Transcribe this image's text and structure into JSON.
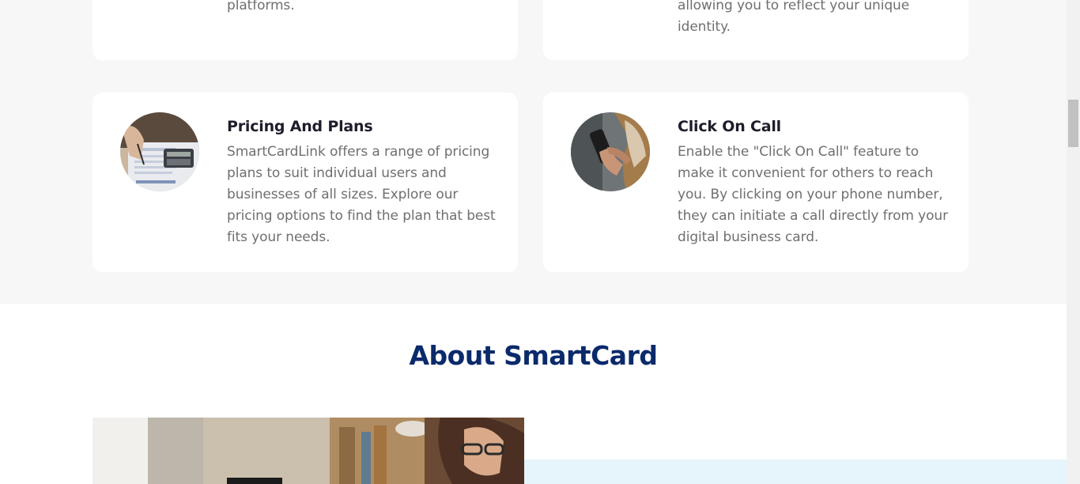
{
  "top_cards": {
    "left_tail": "platforms.",
    "right_tail_line1": "allowing you to reflect your unique",
    "right_tail_line2": "identity."
  },
  "cards": [
    {
      "title": "Pricing And Plans",
      "lines": [
        "SmartCardLink offers a range of pricing",
        "plans to suit individual users and",
        "businesses of all sizes. Explore our",
        "pricing options to find the plan that best",
        "fits your needs."
      ],
      "image_icon": "pricing-photo"
    },
    {
      "title": "Click On Call",
      "lines": [
        "Enable the \"Click On Call\" feature to",
        "make it convenient for others to reach",
        "you. By clicking on your phone number,",
        "they can initiate a call directly from your",
        "digital business card."
      ],
      "image_icon": "phone-call-photo"
    }
  ],
  "about": {
    "title": "About SmartCard"
  },
  "colors": {
    "band_bg": "#f7f7f7",
    "card_bg": "#ffffff",
    "title_color": "#1d1d2b",
    "body_text": "#6f6f6f",
    "about_title": "#0a2a6b",
    "about_panel": "#e6f4fb"
  }
}
